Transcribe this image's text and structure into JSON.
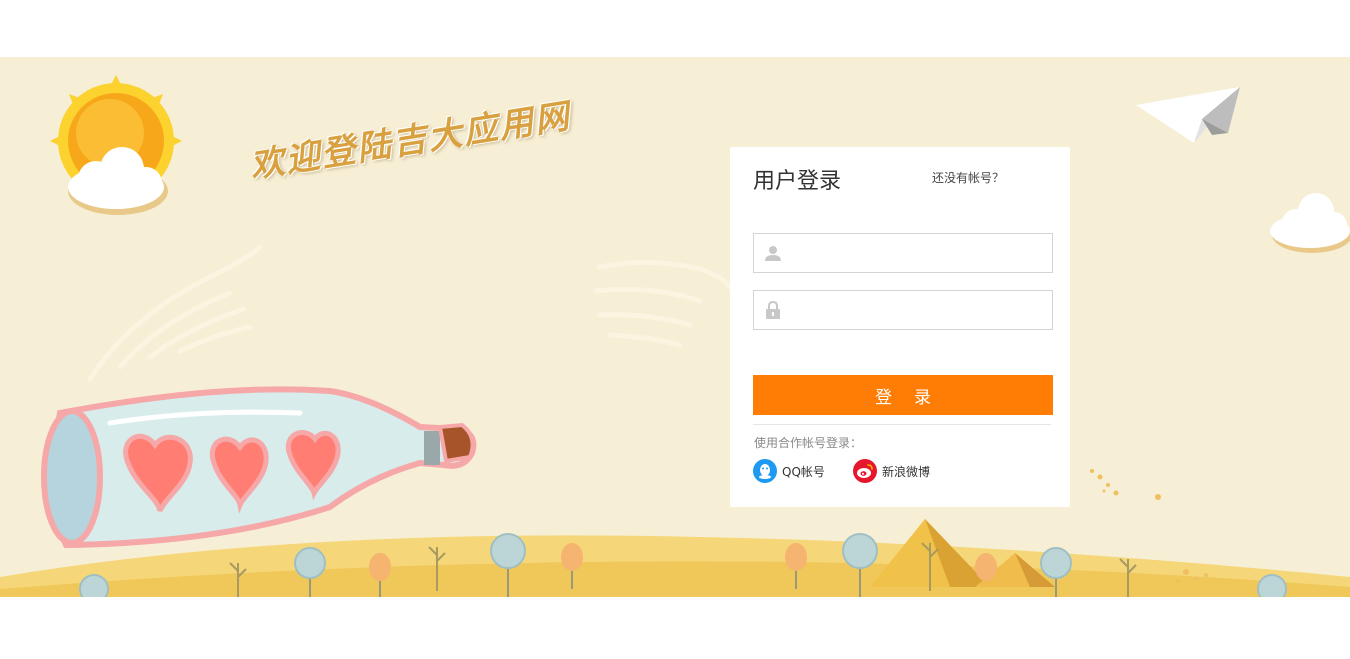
{
  "banner": {
    "welcome_text": "欢迎登陆吉大应用网"
  },
  "login": {
    "title": "用户登录",
    "register_link": "还没有帐号？",
    "username": {
      "value": "",
      "placeholder": ""
    },
    "password": {
      "value": "",
      "placeholder": ""
    },
    "submit_label": "登录",
    "partner_label": "使用合作帐号登录：",
    "partners": [
      {
        "label": "QQ帐号",
        "icon": "qq-icon"
      },
      {
        "label": "新浪微博",
        "icon": "weibo-icon"
      }
    ]
  },
  "colors": {
    "banner_bg": "#f6efd6",
    "accent": "#ff7c05",
    "qq_blue": "#1e9af0",
    "weibo_red": "#e6162d"
  }
}
